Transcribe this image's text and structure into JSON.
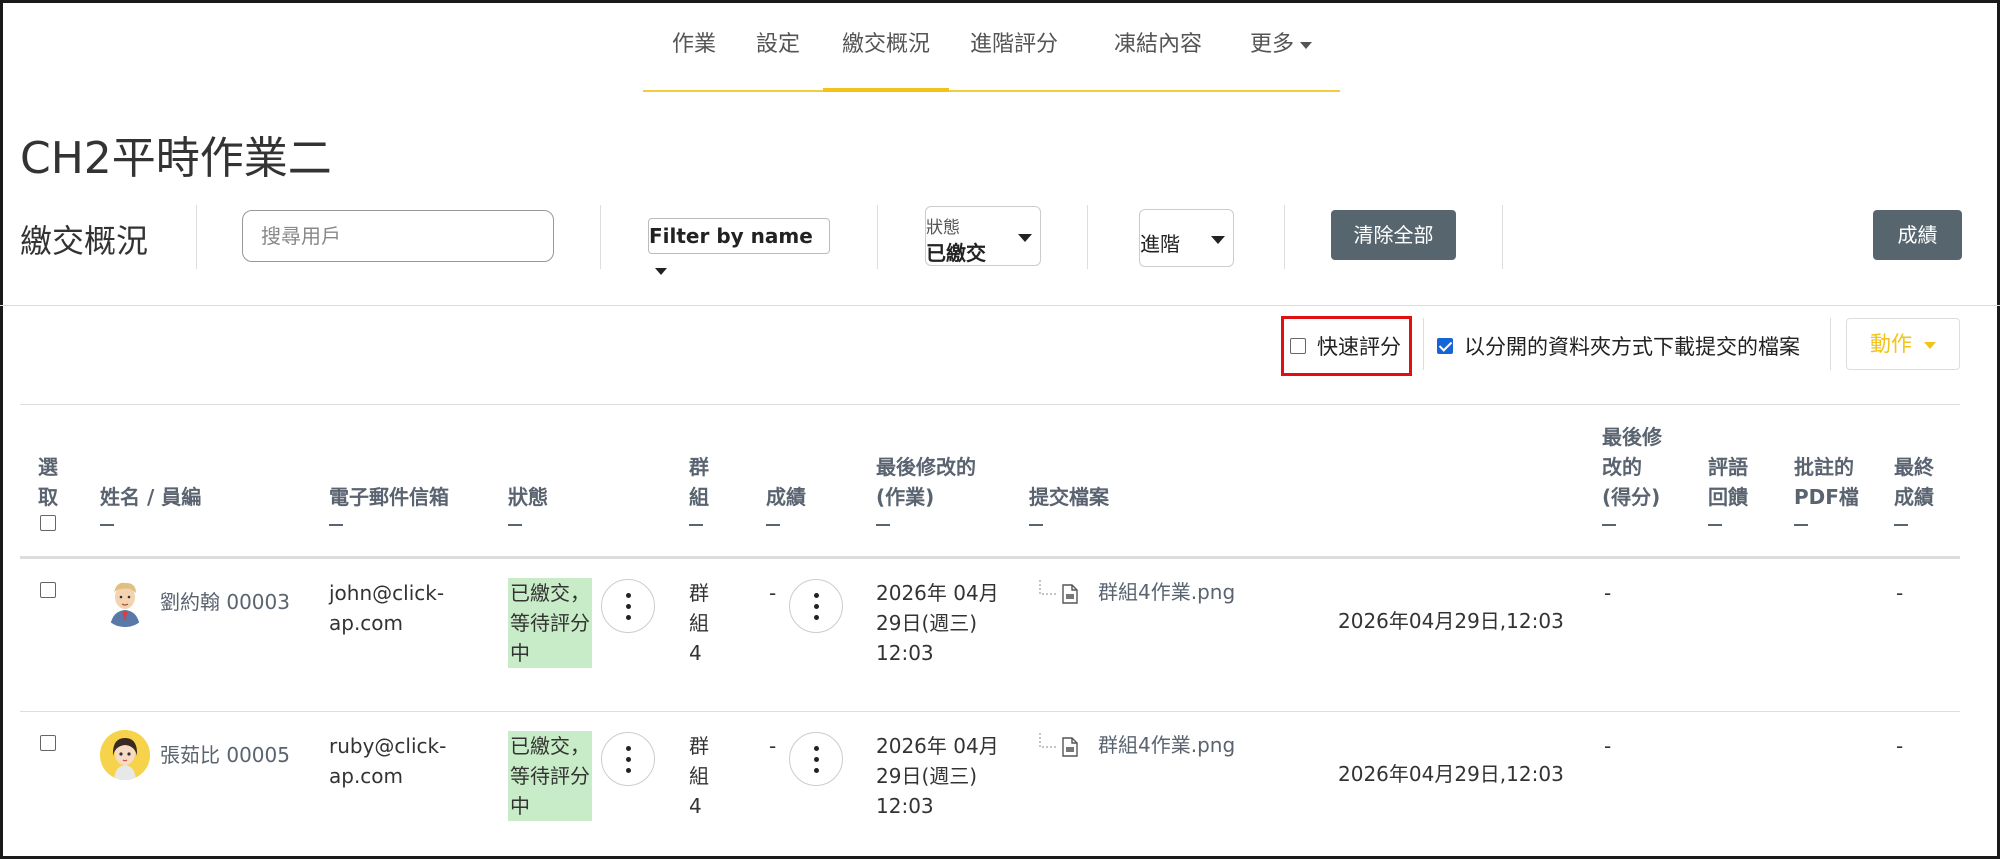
{
  "nav": {
    "items": [
      "作業",
      "設定",
      "繳交概況",
      "進階評分",
      "凍結內容",
      "更多"
    ],
    "active_index": 2
  },
  "page_title": "CH2平時作業二",
  "filters": {
    "section_title": "繳交概況",
    "search_placeholder": "搜尋用戶",
    "filter_by_name": "Filter by name",
    "status_label": "狀態",
    "status_value": "已繳交",
    "advanced_value": "進階",
    "clear_all": "清除全部",
    "grades_button": "成績"
  },
  "options": {
    "quick_grading": "快速評分",
    "quick_grading_checked": false,
    "download_folders": "以分開的資料夾方式下載提交的檔案",
    "download_folders_checked": true,
    "actions": "動作"
  },
  "table": {
    "headers": {
      "select": "選取",
      "name": "姓名 / 員編",
      "email": "電子郵件信箱",
      "status": "狀態",
      "group": "群組",
      "grade": "成績",
      "last_modified_submission": "最後修改的(作業)",
      "files": "提交檔案",
      "last_modified_grade": "最後修改的(得分)",
      "feedback": "評語回饋",
      "annotated_pdf": "批註的PDF檔",
      "final_grade": "最終成績"
    },
    "rows": [
      {
        "name": "劉約翰 00003",
        "email": "john@click-ap.com",
        "status": "已繳交，等待評分中",
        "group": "群組4",
        "grade": "-",
        "modified": "2026年 04月 29日(週三) 12:03",
        "file_name": "群組4作業.png",
        "file_time": "2026年04月29日,12:03",
        "grade_modified": "-",
        "final_grade": "-"
      },
      {
        "name": "張茹比 00005",
        "email": "ruby@click-ap.com",
        "status": "已繳交，等待評分中",
        "group": "群組4",
        "grade": "-",
        "modified": "2026年 04月 29日(週三) 12:03",
        "file_name": "群組4作業.png",
        "file_time": "2026年04月29日,12:03",
        "grade_modified": "-",
        "final_grade": "-"
      }
    ]
  },
  "colors": {
    "accent_yellow": "#f2c318",
    "dark_button": "#57666e",
    "status_green": "#c8ecc7",
    "highlight_red": "#e01010",
    "link_gray": "#5a6470"
  }
}
